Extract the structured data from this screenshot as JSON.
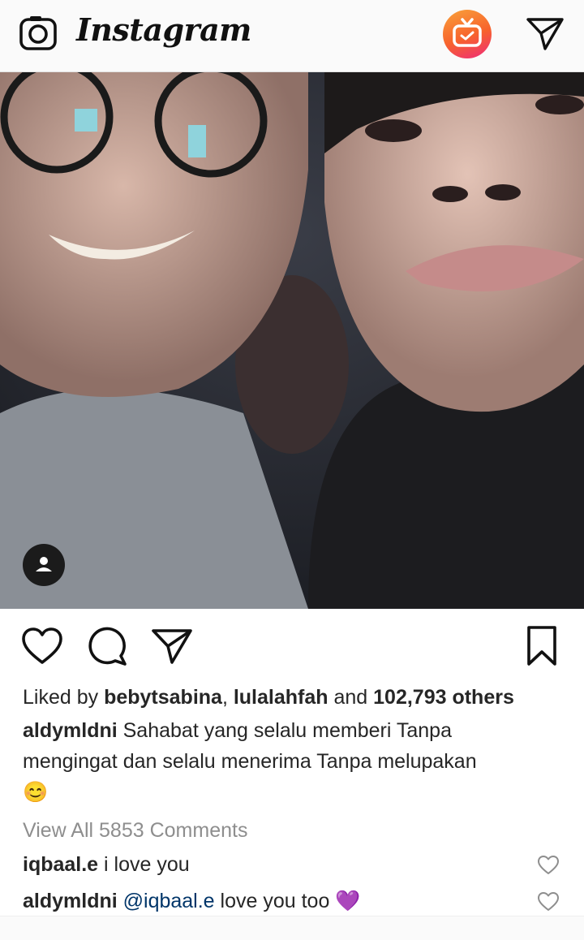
{
  "header": {
    "brand": "Instagram",
    "icons": [
      "camera-icon",
      "igtv-icon",
      "direct-message-icon"
    ]
  },
  "post": {
    "photo_alt": "Selfie of two young men",
    "tag_icon": "user-tag-icon",
    "actions": [
      "like-icon",
      "comment-icon",
      "share-icon",
      "bookmark-icon"
    ],
    "likes": {
      "prefix": "Liked by ",
      "user1": "bebytsabina",
      "sep": ", ",
      "user2": "lulalahfah",
      "and": " and ",
      "others": "102,793 others"
    },
    "caption": {
      "username": "aldymldni",
      "line1": " Sahabat yang selalu memberi Tanpa",
      "line2": "mengingat dan selalu menerima Tanpa melupakan",
      "emoji": "😊"
    },
    "view_all": "View All 5853 Comments",
    "comments": [
      {
        "username": "iqbaal.e",
        "text": " i love you"
      },
      {
        "username": "aldymldni",
        "mention": " @iqbaal.e",
        "text": " love you too",
        "emoji": "💜"
      }
    ]
  },
  "colors": {
    "link": "#003569",
    "muted": "#8e8e8e",
    "igtv_gradient": [
      "#f9a23a",
      "#ee2a7b"
    ]
  }
}
